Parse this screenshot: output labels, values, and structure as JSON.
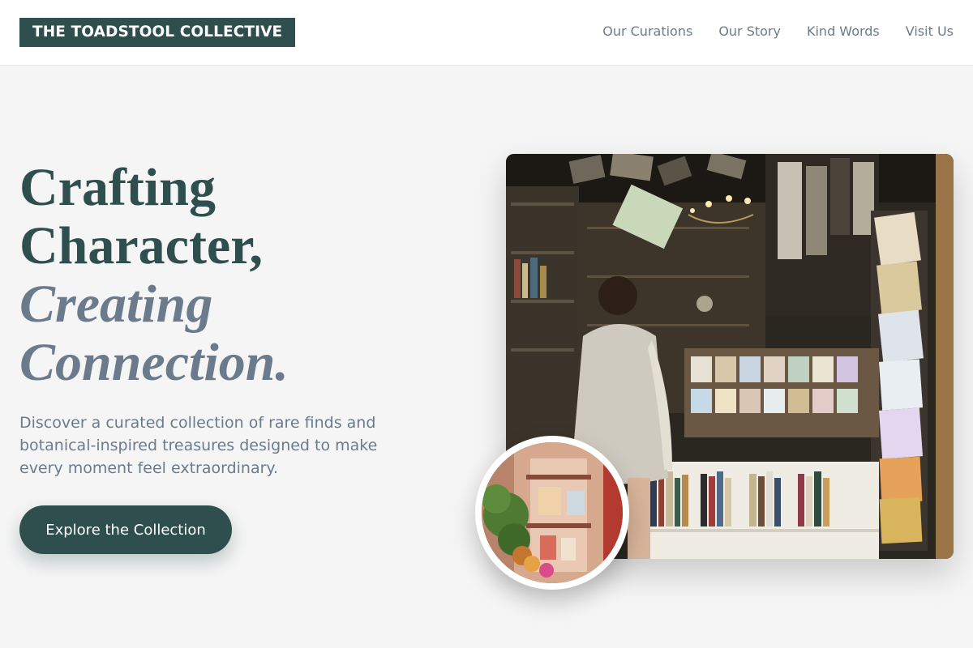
{
  "brand": {
    "name": "THE TOADSTOOL COLLECTIVE"
  },
  "nav": {
    "items": [
      {
        "label": "Our Curations"
      },
      {
        "label": "Our Story"
      },
      {
        "label": "Kind Words"
      },
      {
        "label": "Visit Us"
      }
    ]
  },
  "hero": {
    "line1": "Crafting",
    "line2": "Character,",
    "line3": "Creating",
    "line4": "Connection.",
    "subtext": "Discover a curated collection of rare finds and botanical-inspired treasures designed to make every moment feel extraordinary.",
    "cta_label": "Explore the Collection"
  },
  "colors": {
    "accent": "#2f4f4f",
    "muted_text": "#6b7b8c",
    "background": "#f5f5f5"
  }
}
